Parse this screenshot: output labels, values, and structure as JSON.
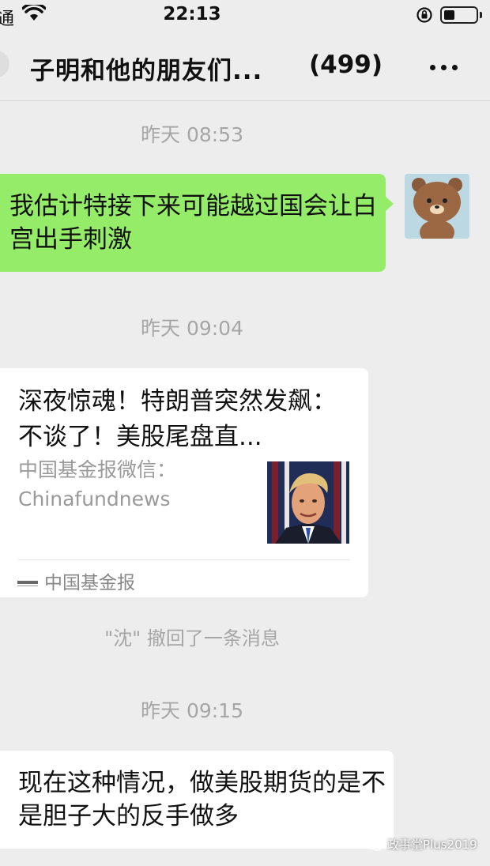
{
  "status_bar": {
    "carrier": "通",
    "time": "22:13",
    "icons": [
      "wifi-icon",
      "rotation-lock-icon",
      "battery-icon"
    ]
  },
  "nav": {
    "title": "子明和他的朋友们...",
    "member_count": "(499)",
    "more_icon": "more-dots-icon"
  },
  "messages": [
    {
      "type": "timestamp",
      "text": "昨天 08:53"
    },
    {
      "type": "text",
      "direction": "outgoing",
      "text": "我估计特接下来可能越过国会让白宫出手刺激",
      "avatar_icon": "brown-bear-avatar"
    },
    {
      "type": "timestamp",
      "text": "昨天 09:04"
    },
    {
      "type": "link_card",
      "direction": "incoming",
      "title": "深夜惊魂！特朗普突然发飙：不谈了！美股尾盘直...",
      "description": "中国基金报微信：Chinafundnews",
      "source": "中国基金报",
      "thumbnail_icon": "portrait-thumbnail"
    },
    {
      "type": "system",
      "text": "\"沈\" 撤回了一条消息"
    },
    {
      "type": "timestamp",
      "text": "昨天 09:15"
    },
    {
      "type": "text",
      "direction": "incoming",
      "text": "现在这种情况，做美股期货的是不是胆子大的反手做多"
    }
  ],
  "watermark": "政事堂Plus2019",
  "colors": {
    "background": "#ededed",
    "outgoing_bubble": "#95ec69",
    "incoming_bubble": "#ffffff",
    "timestamp_text": "#a6a6a6"
  }
}
